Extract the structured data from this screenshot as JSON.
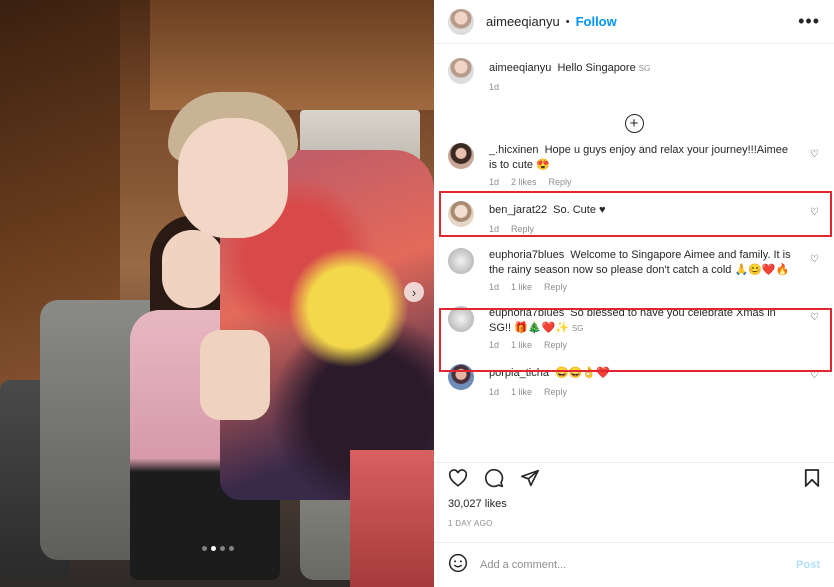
{
  "post": {
    "author": "aimeeqianyu",
    "follow_label": "Follow",
    "more_label": "•••",
    "caption": {
      "user": "aimeeqianyu",
      "text": "Hello Singapore",
      "flag": "SG",
      "time": "1d"
    },
    "likes": "30,027 likes",
    "posted": "1 DAY AGO",
    "add_comment_placeholder": "Add a comment...",
    "post_label": "Post"
  },
  "comments": [
    {
      "user": "_.hicxinen",
      "text": "Hope u guys enjoy and relax your journey!!!Aimee is to cute",
      "emoji": "😍",
      "time": "1d",
      "likes": "2 likes",
      "reply": "Reply",
      "highlighted": true
    },
    {
      "user": "ben_jarat22",
      "text": "So. Cute",
      "emoji": "♥",
      "time": "1d",
      "likes": "",
      "reply": "Reply",
      "highlighted": false
    },
    {
      "user": "euphoria7blues",
      "text": "Welcome to Singapore Aimee and family. It is the rainy season now so please don't catch a cold",
      "emoji": "🙏😊❤️🔥",
      "time": "1d",
      "likes": "1 like",
      "reply": "Reply",
      "highlighted": true
    },
    {
      "user": "euphoria7blues",
      "text": "So blessed to have you celebrate Xmas in SG!!",
      "emoji": "🎁🎄❤️✨",
      "flag": "SG",
      "time": "1d",
      "likes": "1 like",
      "reply": "Reply",
      "highlighted": false
    },
    {
      "user": "porpia_ticha",
      "text": "",
      "emoji": "😀😀👌❤️",
      "time": "1d",
      "likes": "1 like",
      "reply": "Reply",
      "highlighted": false
    }
  ],
  "icons": [
    "heart-icon",
    "comment-icon",
    "share-icon",
    "bookmark-icon",
    "emoji-icon",
    "plus-circle-icon",
    "more-icon",
    "chevron-right-icon"
  ],
  "colors": {
    "follow": "#0095f6",
    "highlight": "#e0262f",
    "post_disabled": "#b2dffc",
    "muted": "#8e8e8e"
  },
  "carousel": {
    "dots": 4,
    "active": 1
  }
}
